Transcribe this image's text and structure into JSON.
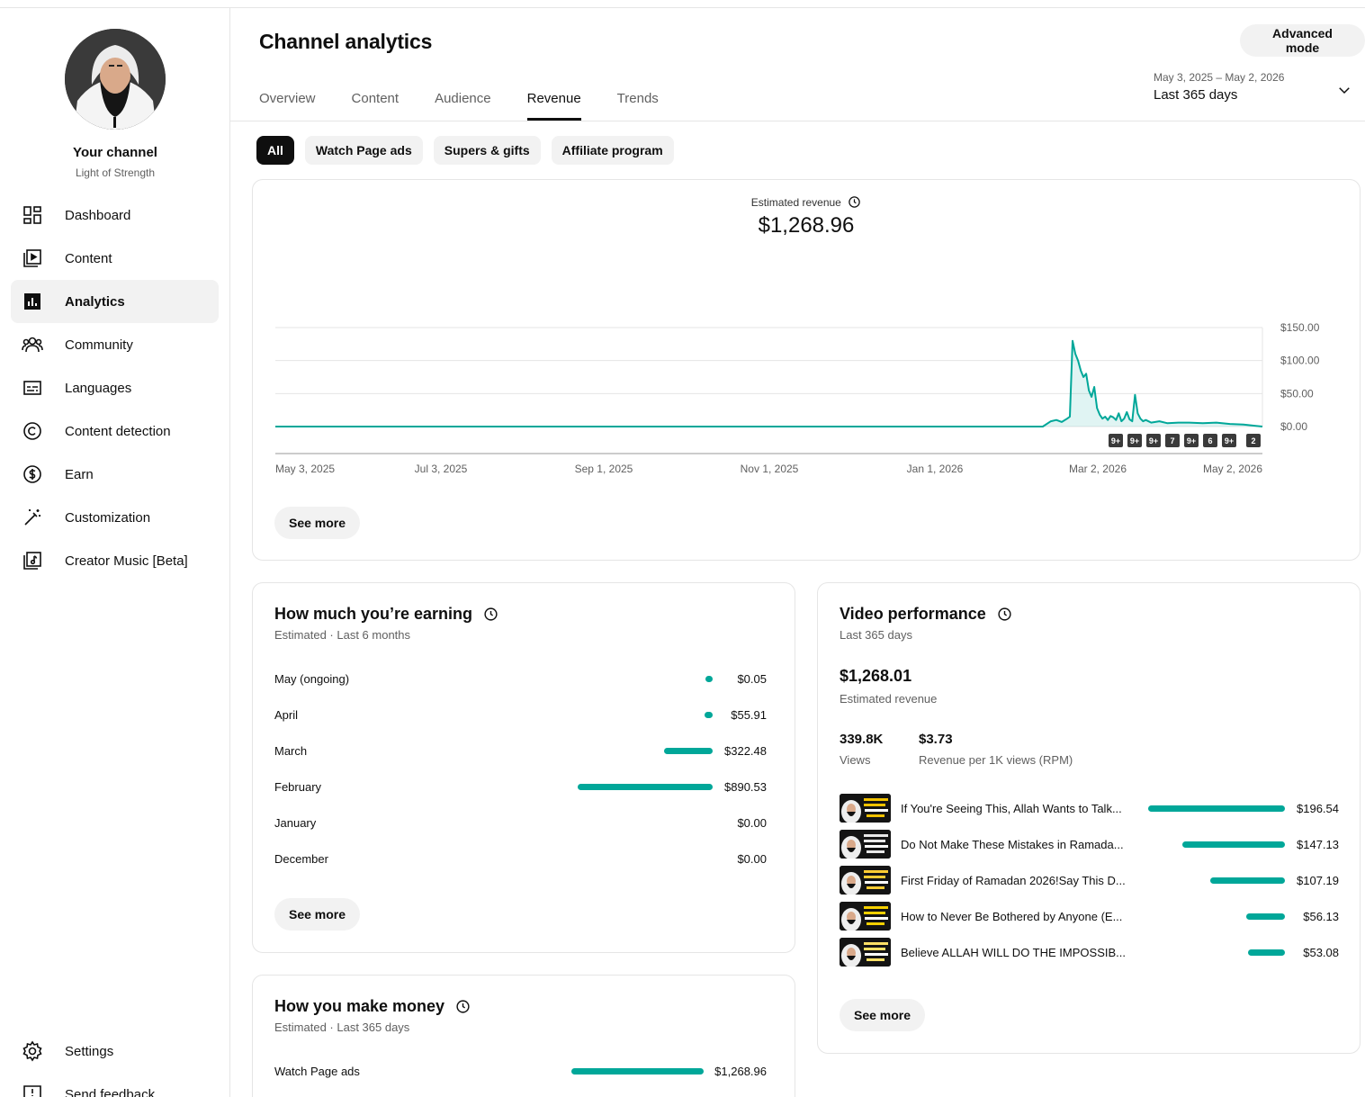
{
  "sidebar": {
    "channel_title": "Your channel",
    "channel_name": "Light of Strength",
    "items": [
      {
        "label": "Dashboard",
        "icon": "dashboard-icon"
      },
      {
        "label": "Content",
        "icon": "content-icon"
      },
      {
        "label": "Analytics",
        "icon": "analytics-icon",
        "active": true
      },
      {
        "label": "Community",
        "icon": "community-icon"
      },
      {
        "label": "Languages",
        "icon": "languages-icon"
      },
      {
        "label": "Content detection",
        "icon": "copyright-icon"
      },
      {
        "label": "Earn",
        "icon": "dollar-icon"
      },
      {
        "label": "Customization",
        "icon": "magic-wand-icon"
      },
      {
        "label": "Creator Music [Beta]",
        "icon": "music-icon"
      }
    ],
    "bottom_items": [
      {
        "label": "Settings",
        "icon": "gear-icon"
      },
      {
        "label": "Send feedback",
        "icon": "feedback-icon"
      }
    ]
  },
  "header": {
    "title": "Channel analytics",
    "advanced_mode": "Advanced mode",
    "tabs": [
      "Overview",
      "Content",
      "Audience",
      "Revenue",
      "Trends"
    ],
    "active_tab": "Revenue",
    "date_range": "May 3, 2025 – May 2, 2026",
    "date_period": "Last 365 days"
  },
  "chips": [
    "All",
    "Watch Page ads",
    "Supers & gifts",
    "Affiliate program"
  ],
  "revenue_card": {
    "label": "Estimated revenue",
    "value": "$1,268.96",
    "see_more": "See more",
    "badges": [
      "9+",
      "9+",
      "9+",
      "7",
      "9+",
      "6",
      "9+",
      "2"
    ]
  },
  "chart_data": {
    "type": "area",
    "title": "",
    "x_range": [
      "2025-05-03",
      "2026-05-02"
    ],
    "x_tick_labels": [
      "May 3, 2025",
      "Jul 3, 2025",
      "Sep 1, 2025",
      "Nov 1, 2025",
      "Jan 1, 2026",
      "Mar 2, 2026",
      "May 2, 2026"
    ],
    "y_tick_labels": [
      "$0.00",
      "$50.00",
      "$100.00",
      "$150.00"
    ],
    "ylim": [
      0,
      150
    ],
    "grid": true,
    "color": "#00a799",
    "series": [
      {
        "x": [
          "2025-05-03",
          "2026-02-10",
          "2026-02-13",
          "2026-02-15",
          "2026-02-17",
          "2026-02-19",
          "2026-02-20",
          "2026-02-21",
          "2026-02-22",
          "2026-02-23",
          "2026-02-24",
          "2026-02-25",
          "2026-02-26",
          "2026-02-27",
          "2026-02-28",
          "2026-03-01",
          "2026-03-02",
          "2026-03-03",
          "2026-03-04",
          "2026-03-05",
          "2026-03-06",
          "2026-03-07",
          "2026-03-08",
          "2026-03-09",
          "2026-03-10",
          "2026-03-11",
          "2026-03-12",
          "2026-03-13",
          "2026-03-14",
          "2026-03-15",
          "2026-03-16",
          "2026-03-17",
          "2026-03-18",
          "2026-03-19",
          "2026-03-20",
          "2026-03-22",
          "2026-03-25",
          "2026-03-28",
          "2026-04-01",
          "2026-04-05",
          "2026-04-10",
          "2026-04-15",
          "2026-04-20",
          "2026-04-25",
          "2026-05-02"
        ],
        "y": [
          0,
          0,
          8,
          10,
          7,
          12,
          15,
          130,
          110,
          100,
          85,
          75,
          80,
          55,
          45,
          60,
          28,
          18,
          12,
          15,
          10,
          16,
          14,
          10,
          20,
          8,
          12,
          22,
          11,
          8,
          48,
          20,
          12,
          8,
          10,
          6,
          8,
          5,
          6,
          6,
          5,
          6,
          4,
          3,
          0
        ]
      }
    ]
  },
  "earning_card": {
    "title": "How much you’re earning",
    "subtitle": "Estimated · Last 6 months",
    "rows": [
      {
        "label": "May (ongoing)",
        "value": "$0.05",
        "amount": 0.05
      },
      {
        "label": "April",
        "value": "$55.91",
        "amount": 55.91
      },
      {
        "label": "March",
        "value": "$322.48",
        "amount": 322.48
      },
      {
        "label": "February",
        "value": "$890.53",
        "amount": 890.53
      },
      {
        "label": "January",
        "value": "$0.00",
        "amount": 0
      },
      {
        "label": "December",
        "value": "$0.00",
        "amount": 0
      }
    ],
    "see_more": "See more"
  },
  "money_card": {
    "title": "How you make money",
    "subtitle": "Estimated · Last 365 days",
    "rows": [
      {
        "label": "Watch Page ads",
        "value": "$1,268.96",
        "share": 1.0
      }
    ]
  },
  "video_card": {
    "title": "Video performance",
    "subtitle": "Last 365 days",
    "revenue": "$1,268.01",
    "revenue_label": "Estimated revenue",
    "views": "339.8K",
    "views_label": "Views",
    "rpm": "$3.73",
    "rpm_label": "Revenue per 1K views (RPM)",
    "videos": [
      {
        "title": "If You're Seeing This, Allah Wants to Talk...",
        "value": "$196.54",
        "amount": 196.54
      },
      {
        "title": "Do Not Make These Mistakes in Ramada...",
        "value": "$147.13",
        "amount": 147.13
      },
      {
        "title": "First Friday of Ramadan 2026!Say This D...",
        "value": "$107.19",
        "amount": 107.19
      },
      {
        "title": "How to Never Be Bothered by Anyone (E...",
        "value": "$56.13",
        "amount": 56.13
      },
      {
        "title": "Believe ALLAH WILL DO THE IMPOSSIB...",
        "value": "$53.08",
        "amount": 53.08
      }
    ],
    "see_more": "See more"
  }
}
